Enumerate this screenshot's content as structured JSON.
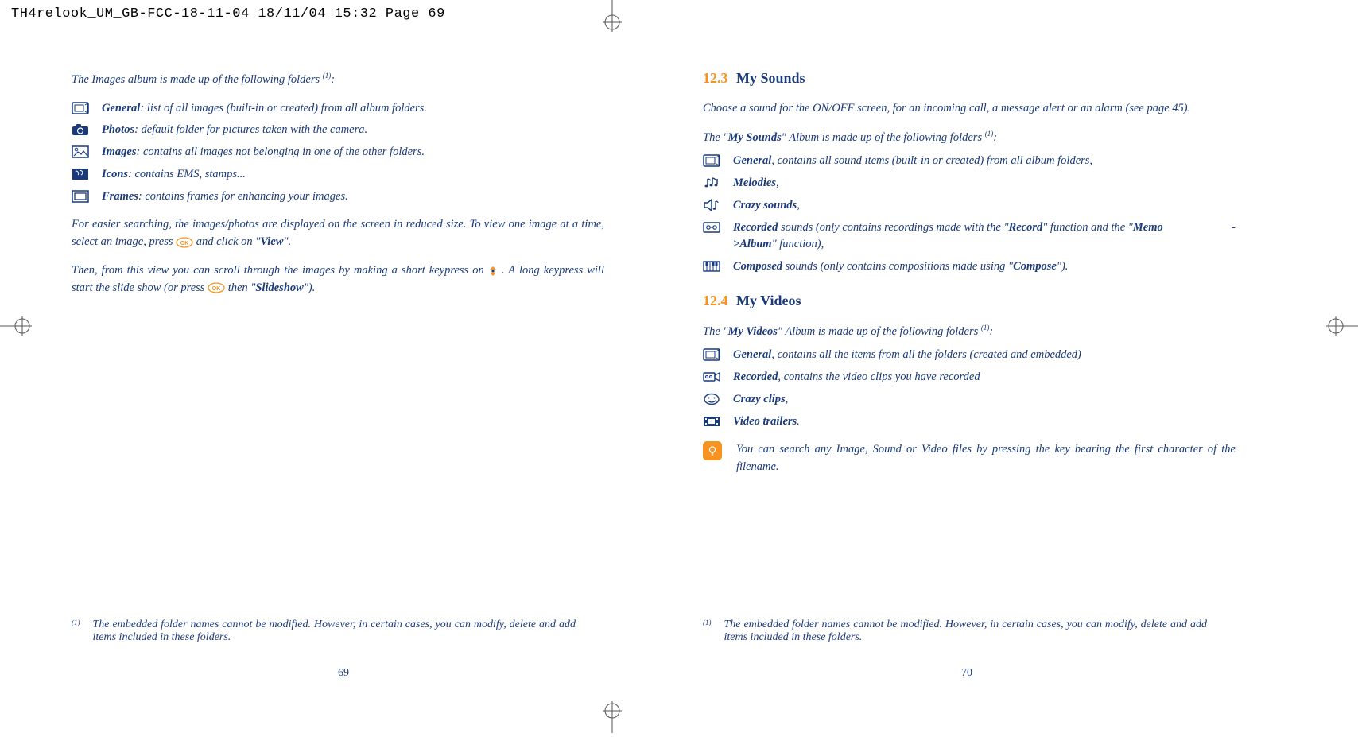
{
  "header": "TH4relook_UM_GB-FCC-18-11-04  18/11/04  15:32  Page 69",
  "left": {
    "intro": "The Images album is made up of the following folders ",
    "intro_sup": "(1)",
    "intro_end": ":",
    "folders": [
      {
        "label": "General",
        "desc": ": list of all images (built-in or created) from all album folders."
      },
      {
        "label": "Photos",
        "desc": ": default folder for pictures taken with the camera."
      },
      {
        "label": "Images",
        "desc": ": contains all images not belonging in one of the other folders."
      },
      {
        "label": "Icons",
        "desc": ": contains EMS, stamps..."
      },
      {
        "label": "Frames",
        "desc": ": contains frames for enhancing your images."
      }
    ],
    "para1a": "For easier searching, the images/photos are displayed on the screen in reduced size. To view one image at a time, select an image, press ",
    "para1b": " and click on \"",
    "para1_bold": "View",
    "para1c": "\".",
    "para2a": "Then, from this view you can scroll through the images by making a short keypress on ",
    "para2b": ". A long keypress will start the slide show (or press ",
    "para2c": " then \"",
    "para2_bold": "Slideshow",
    "para2d": "\").",
    "footnote_sup": "(1)",
    "footnote": "The embedded folder names cannot be modified. However, in certain cases, you can modify, delete and add items included in these folders.",
    "pagenum": "69"
  },
  "right": {
    "s123_num": "12.3",
    "s123_title": "My Sounds",
    "s123_intro": "Choose a sound for the ON/OFF screen, for an incoming call, a message alert or an alarm (see page 45).",
    "s123_line_a": "The \"",
    "s123_line_bold": "My Sounds",
    "s123_line_b": "\" Album is made up of the following folders ",
    "s123_sup": "(1)",
    "s123_line_c": ":",
    "sounds": {
      "general_label": "General",
      "general_desc": ", contains all sound items (built-in or created) from all album folders,",
      "melodies_label": "Melodies",
      "melodies_desc": ",",
      "crazy_label": "Crazy sounds",
      "crazy_desc": ",",
      "rec_label": "Recorded",
      "rec_a": " sounds (only contains recordings made with the \"",
      "rec_b1": "Record",
      "rec_b": "\" function and the \"",
      "rec_b2a": "Memo",
      "rec_dash": "-",
      "rec_b2b": ">Album",
      "rec_c": "\" function),",
      "comp_label": "Composed",
      "comp_a": " sounds (only contains compositions made using \"",
      "comp_b": "Compose",
      "comp_c": "\")."
    },
    "s124_num": "12.4",
    "s124_title": "My Videos",
    "s124_line_a": "The \"",
    "s124_line_bold": "My Videos",
    "s124_line_b": "\" Album is made up of the following folders ",
    "s124_sup": "(1)",
    "s124_line_c": ":",
    "videos": {
      "general_label": "General",
      "general_desc": ", contains all the items from all the folders (created and embedded)",
      "rec_label": "Recorded",
      "rec_desc": ", contains the video clips you have recorded",
      "crazy_label": "Crazy clips",
      "crazy_desc": ",",
      "trail_label": "Video trailers",
      "trail_desc": "."
    },
    "tip": "You can search any Image, Sound or Video files by pressing the key bearing the first character of the filename.",
    "footnote_sup": "(1)",
    "footnote": "The embedded folder names cannot be modified. However, in certain cases, you can modify, delete and add items included in these folders.",
    "pagenum": "70"
  }
}
